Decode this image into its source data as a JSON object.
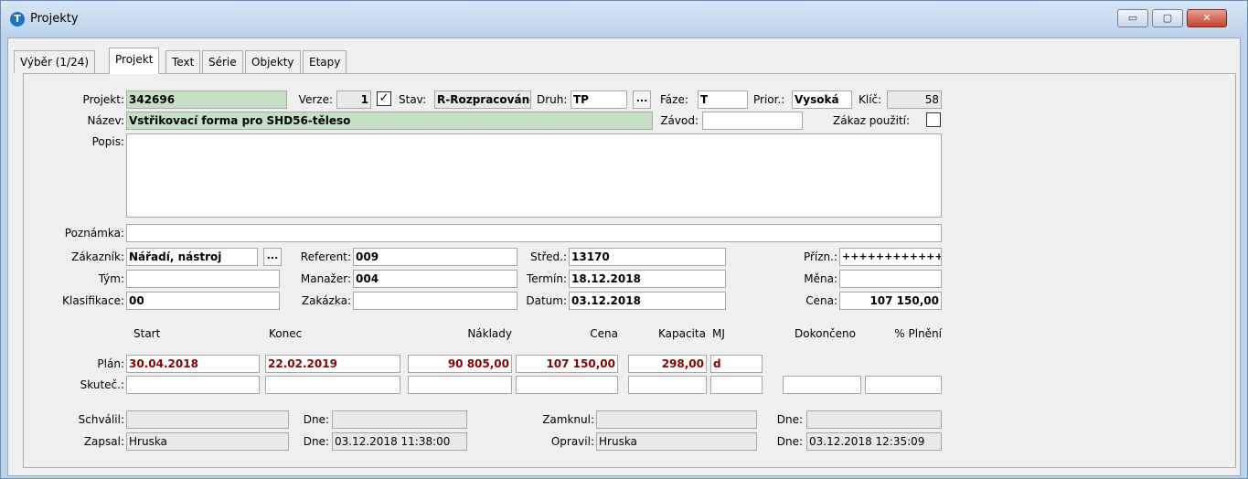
{
  "window": {
    "title": "Projekty",
    "icon": "app-logo-icon",
    "min": "▭",
    "max": "▢",
    "close": "✕"
  },
  "tabs": [
    "Výběr (1/24)",
    "Projekt",
    "Text",
    "Série",
    "Objekty",
    "Etapy"
  ],
  "active_tab": "Projekt",
  "form": {
    "projekt_label": "Projekt:",
    "projekt": "342696",
    "verze_label": "Verze:",
    "verze": "1",
    "verze_check": "✓",
    "stav_label": "Stav:",
    "stav": "R-Rozpracováno",
    "druh_label": "Druh:",
    "druh": "TP",
    "druh_btn": "...",
    "faze_label": "Fáze:",
    "faze": "T",
    "prior_label": "Prior.:",
    "prior": "Vysoká",
    "klic_label": "Klíč:",
    "klic": "58",
    "nazev_label": "Název:",
    "nazev": "Vstřikovací forma pro SHD56-těleso",
    "zavod_label": "Závod:",
    "zavod": "",
    "zakaz_label": "Zákaz použití:",
    "zakaz_check": "",
    "popis_label": "Popis:",
    "popis": "",
    "poznamka_label": "Poznámka:",
    "poznamka": "",
    "zakaznik_label": "Zákazník:",
    "zakaznik": "Nářadí, nástroj",
    "zakaznik_btn": "...",
    "referent_label": "Referent:",
    "referent": "009",
    "stred_label": "Střed.:",
    "stred": "13170",
    "prizn_label": "Přízn.:",
    "prizn": "++++++++++++++",
    "tym_label": "Tým:",
    "tym": "",
    "manazer_label": "Manažer:",
    "manazer": "004",
    "termin_label": "Termín:",
    "termin": "18.12.2018",
    "mena_label": "Měna:",
    "mena": "",
    "klasifikace_label": "Klasifikace:",
    "klasifikace": "00",
    "zakazka_label": "Zakázka:",
    "zakazka": "",
    "datum_label": "Datum:",
    "datum": "03.12.2018",
    "cena_label": "Cena:",
    "cena": "107 150,00"
  },
  "plan_headers": {
    "start": "Start",
    "konec": "Konec",
    "naklady": "Náklady",
    "cena": "Cena",
    "kapacita": "Kapacita",
    "mj": "MJ",
    "dokonceno": "Dokončeno",
    "plneni": "% Plnění"
  },
  "plan": {
    "label": "Plán:",
    "start": "30.04.2018",
    "konec": "22.02.2019",
    "naklady": "90 805,00",
    "cena": "107 150,00",
    "kapacita": "298,00",
    "mj": "d"
  },
  "skutec": {
    "label": "Skuteč.:",
    "start": "",
    "konec": "",
    "naklady": "",
    "cena": "",
    "kapacita": "",
    "mj": "",
    "dokonceno": "",
    "plneni": ""
  },
  "audit": {
    "schvalil_label": "Schválil:",
    "schvalil": "",
    "dne1_label": "Dne:",
    "dne1": "",
    "zamknul_label": "Zamknul:",
    "zamknul": "",
    "dne2_label": "Dne:",
    "dne2": "",
    "zapsal_label": "Zapsal:",
    "zapsal": "Hruska",
    "dne3_label": "Dne:",
    "dne3": "03.12.2018 11:38:00",
    "opravil_label": "Opravil:",
    "opravil": "Hruska",
    "dne4_label": "Dne:",
    "dne4": "03.12.2018 12:35:09"
  },
  "colors": {
    "green_field": "#c6e0c6",
    "red_text": "#8b0000",
    "titlebar": "#bcd3ea"
  }
}
